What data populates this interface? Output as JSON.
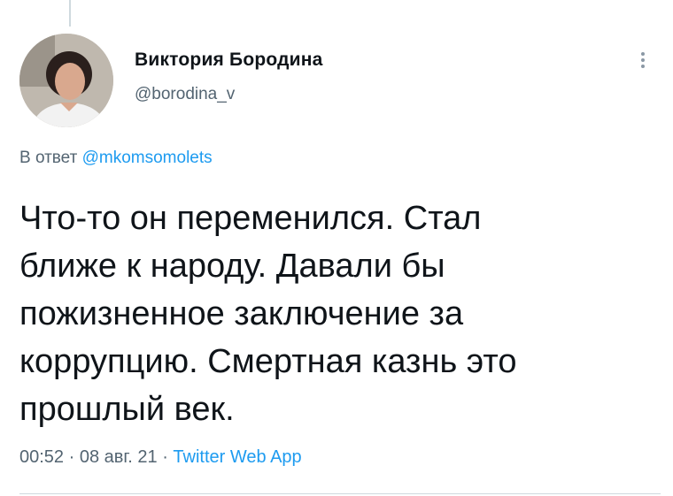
{
  "tweet": {
    "author": {
      "display_name": "Виктория Бородина",
      "handle": "@borodina_v",
      "avatar_icon": "user-avatar-photo"
    },
    "reply": {
      "prefix": "В ответ",
      "mention": "@mkomsomolets"
    },
    "text": "Что-то он переменился. Стал\nближе к народу. Давали бы\nпожизненное заключение за\nкоррупцию. Смертная казнь это\nпрошлый век.",
    "meta": {
      "time": "00:52",
      "separator": "·",
      "date": "08 авг. 21",
      "source": "Twitter Web App"
    },
    "more_icon": "more-vertical-icon"
  }
}
